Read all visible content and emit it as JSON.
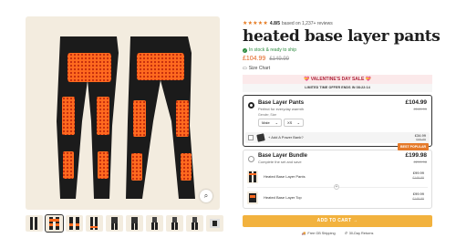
{
  "product": {
    "rating_value": "4.8/5",
    "rating_stars": "★★★★★",
    "reviews_text": "based on 1,237+ reviews",
    "title": "heated base layer pants",
    "stock": "In stock & ready to ship",
    "price": "£104.99",
    "was_price": "£149.99",
    "size_chart": "Size Chart"
  },
  "banners": {
    "valentine": "💝 VALENTINE'S DAY SALE 💝",
    "offer": "LIMITED TIME OFFER ENDS IN 08:22:14"
  },
  "options": {
    "pants": {
      "name": "Base Layer Pants",
      "subtitle": "Perfect for everyday warmth",
      "price": "£104.99",
      "was": "£149.99",
      "gender_size_label": "Gender, Size",
      "gender": "Male",
      "size": "XS",
      "addon_label": "+ Add A Power Bank?",
      "addon_price": "£34.99",
      "addon_was": "£69.99"
    },
    "bundle": {
      "badge": "BEST POPULAR",
      "name": "Base Layer Bundle",
      "subtitle": "Complete the set and save",
      "price": "£199.98",
      "was": "£299.98",
      "items": [
        {
          "name": "Heated Base Layer Pants",
          "price": "£99.99",
          "was": "£149.99"
        },
        {
          "name": "Heated Base Layer Top",
          "price": "£99.99",
          "was": "£149.99"
        }
      ]
    }
  },
  "cart": {
    "label": "ADD TO CART →"
  },
  "perks": {
    "shipping": "Free GB Shipping",
    "returns": "30-Day Returns"
  },
  "icons": {
    "zoom": "zoom-icon",
    "check": "check-circle-icon",
    "ruler": "ruler-icon",
    "truck": "truck-icon",
    "returns": "returns-icon"
  },
  "colors": {
    "accent": "#e2611c",
    "cart": "#f2b23e",
    "stock": "#2b8a3e",
    "heater": "#ff5a1a"
  }
}
